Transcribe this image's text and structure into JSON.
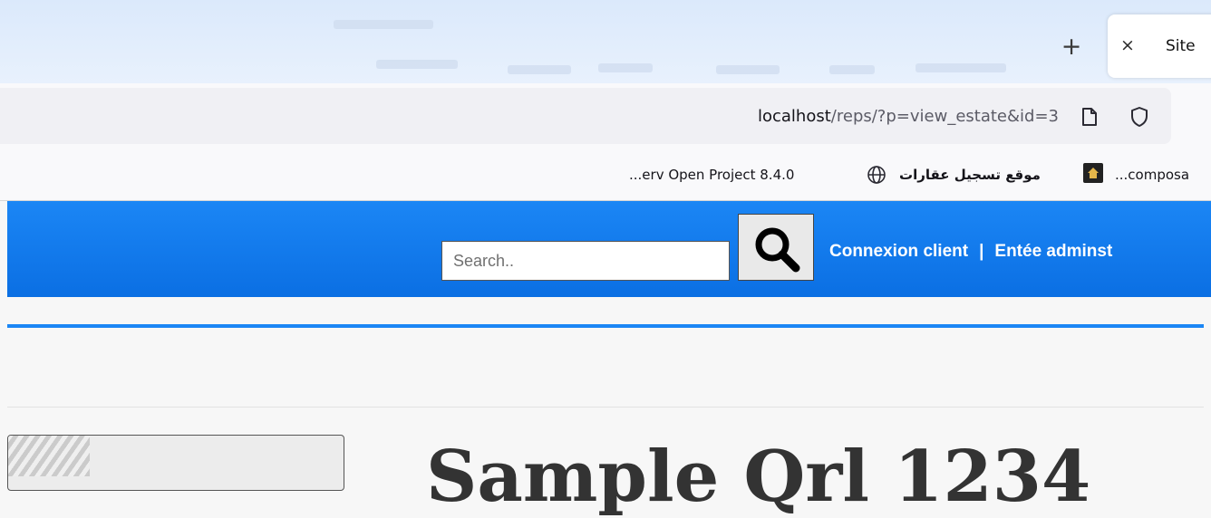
{
  "browser": {
    "new_tab_symbol": "+",
    "tab": {
      "close_symbol": "×",
      "title": "Site"
    },
    "address": {
      "host": "localhost",
      "path": "/reps/?p=view_estate&id=3"
    },
    "bookmarks": [
      {
        "label": "...erv Open Project 8.4.0",
        "icon": "globe-icon"
      },
      {
        "label": "موقع تسجيل عقارات",
        "icon": "house-icon"
      },
      {
        "label": "...composa"
      }
    ]
  },
  "site": {
    "search_placeholder": "Search..",
    "links": {
      "client": "Connexion client",
      "separator": "|",
      "admin": "Entée adminst"
    },
    "colors": {
      "header": "#1b86f5",
      "rule": "#1b86f5"
    },
    "heading": "Sample Qrl 1234"
  }
}
